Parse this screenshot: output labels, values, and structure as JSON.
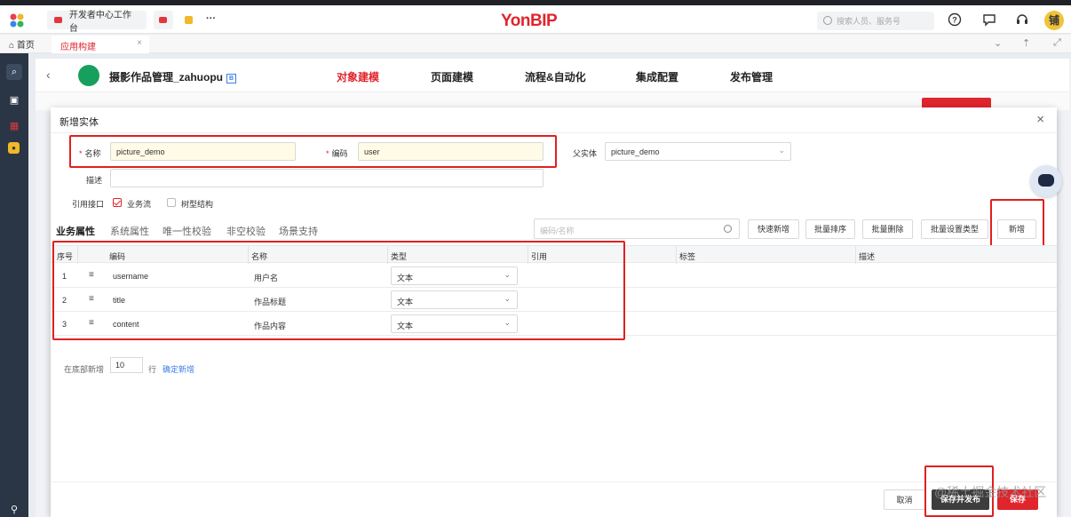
{
  "topbar": {
    "tab1": "开发者中心工作台",
    "more": "···",
    "brand": "YonBIP",
    "search_placeholder": "搜索人员、服务号",
    "avatar": "铺"
  },
  "navbar": {
    "home": "首页",
    "active_tab": "应用构建",
    "close": "×"
  },
  "app": {
    "title": "摄影作品管理_zahuopu",
    "badge": "B",
    "menus": [
      "对象建模",
      "页面建模",
      "流程&自动化",
      "集成配置",
      "发布管理"
    ],
    "active_menu": "对象建模"
  },
  "dialog": {
    "title": "新增实体",
    "close": "×",
    "name_label": "名称",
    "name_value": "picture_demo",
    "code_label": "编码",
    "code_value": "user",
    "parent_label": "父实体",
    "parent_value": "picture_demo",
    "desc_label": "描述",
    "desc_value": "",
    "interface_label": "引用接口",
    "cb_business_flow": "业务流",
    "cb_tree": "树型结构",
    "tabs": [
      "业务属性",
      "系统属性",
      "唯一性校验",
      "非空校验",
      "场景支持"
    ],
    "search_placeholder": "编码/名称",
    "buttons": [
      "快速新增",
      "批量排序",
      "批量删除",
      "批量设置类型",
      "新增"
    ],
    "columns": [
      "序号",
      "编码",
      "名称",
      "类型",
      "引用",
      "标签",
      "描述"
    ],
    "rows": [
      {
        "no": "1",
        "code": "username",
        "name": "用户名",
        "type": "文本"
      },
      {
        "no": "2",
        "code": "title",
        "name": "作品标题",
        "type": "文本"
      },
      {
        "no": "3",
        "code": "content",
        "name": "作品内容",
        "type": "文本"
      }
    ],
    "bottom_add_label": "在底部新增",
    "bottom_add_count": "10",
    "bottom_add_unit": "行",
    "confirm_add": "确定新增",
    "footer": {
      "cancel": "取消",
      "save_publish": "保存并发布",
      "save": "保存"
    }
  },
  "watermark": "@稀土掘金技术社区",
  "colors": {
    "accent": "#e0252d",
    "highlight": "#e02020",
    "link": "#3a7de8"
  }
}
